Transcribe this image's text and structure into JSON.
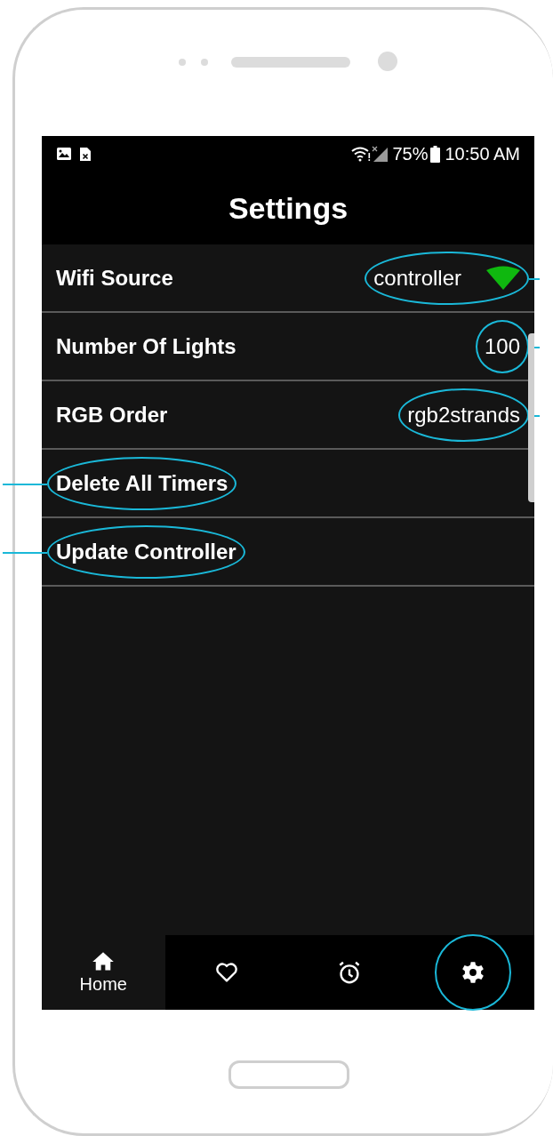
{
  "status_bar": {
    "battery": "75%",
    "time": "10:50 AM"
  },
  "title": "Settings",
  "rows": [
    {
      "label": "Wifi Source",
      "value": "controller",
      "kind": "wifi-value",
      "label_circled": false,
      "value_circled": true
    },
    {
      "label": "Number Of Lights",
      "value": "100",
      "kind": "value",
      "label_circled": false,
      "value_circled": true
    },
    {
      "label": "RGB Order",
      "value": "rgb2strands",
      "kind": "value",
      "label_circled": false,
      "value_circled": true
    },
    {
      "label": "Delete All Timers",
      "kind": "action",
      "label_circled": true,
      "value_circled": false
    },
    {
      "label": "Update Controller",
      "kind": "action",
      "label_circled": true,
      "value_circled": false
    }
  ],
  "nav": [
    {
      "kind": "home",
      "label": "Home",
      "selected": true,
      "callout": false
    },
    {
      "kind": "heart",
      "selected": false,
      "callout": false
    },
    {
      "kind": "alarm",
      "selected": false,
      "callout": false
    },
    {
      "kind": "gear",
      "selected": false,
      "callout": true
    }
  ]
}
